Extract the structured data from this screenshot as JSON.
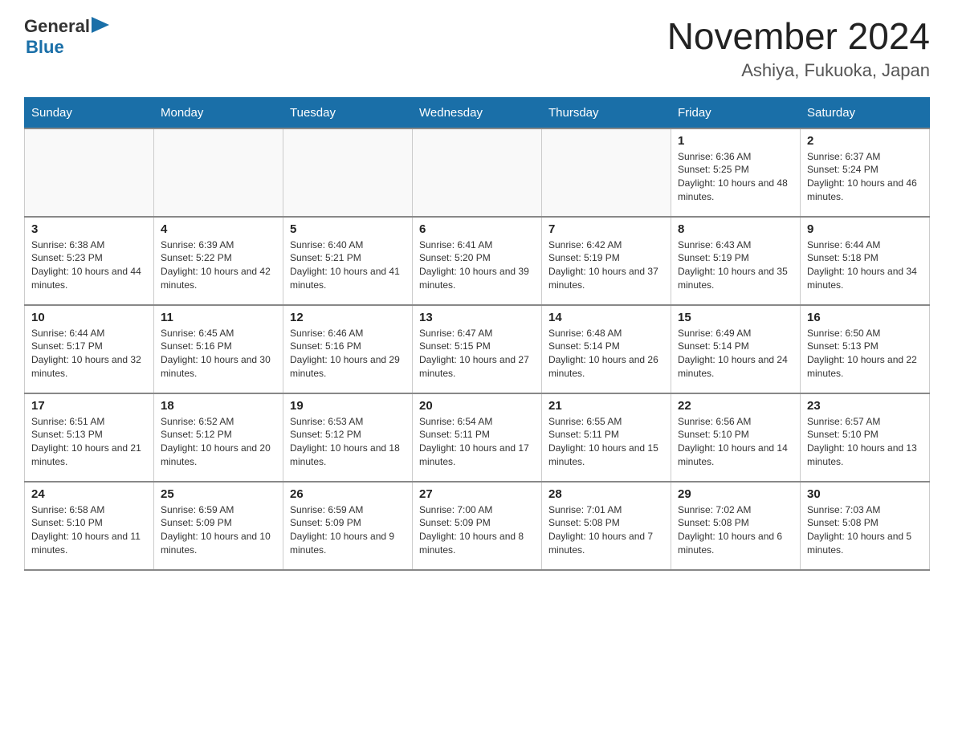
{
  "logo": {
    "general": "General",
    "blue": "Blue",
    "triangle": "▶"
  },
  "title": "November 2024",
  "subtitle": "Ashiya, Fukuoka, Japan",
  "days_of_week": [
    "Sunday",
    "Monday",
    "Tuesday",
    "Wednesday",
    "Thursday",
    "Friday",
    "Saturday"
  ],
  "weeks": [
    [
      {
        "day": "",
        "info": ""
      },
      {
        "day": "",
        "info": ""
      },
      {
        "day": "",
        "info": ""
      },
      {
        "day": "",
        "info": ""
      },
      {
        "day": "",
        "info": ""
      },
      {
        "day": "1",
        "info": "Sunrise: 6:36 AM\nSunset: 5:25 PM\nDaylight: 10 hours and 48 minutes."
      },
      {
        "day": "2",
        "info": "Sunrise: 6:37 AM\nSunset: 5:24 PM\nDaylight: 10 hours and 46 minutes."
      }
    ],
    [
      {
        "day": "3",
        "info": "Sunrise: 6:38 AM\nSunset: 5:23 PM\nDaylight: 10 hours and 44 minutes."
      },
      {
        "day": "4",
        "info": "Sunrise: 6:39 AM\nSunset: 5:22 PM\nDaylight: 10 hours and 42 minutes."
      },
      {
        "day": "5",
        "info": "Sunrise: 6:40 AM\nSunset: 5:21 PM\nDaylight: 10 hours and 41 minutes."
      },
      {
        "day": "6",
        "info": "Sunrise: 6:41 AM\nSunset: 5:20 PM\nDaylight: 10 hours and 39 minutes."
      },
      {
        "day": "7",
        "info": "Sunrise: 6:42 AM\nSunset: 5:19 PM\nDaylight: 10 hours and 37 minutes."
      },
      {
        "day": "8",
        "info": "Sunrise: 6:43 AM\nSunset: 5:19 PM\nDaylight: 10 hours and 35 minutes."
      },
      {
        "day": "9",
        "info": "Sunrise: 6:44 AM\nSunset: 5:18 PM\nDaylight: 10 hours and 34 minutes."
      }
    ],
    [
      {
        "day": "10",
        "info": "Sunrise: 6:44 AM\nSunset: 5:17 PM\nDaylight: 10 hours and 32 minutes."
      },
      {
        "day": "11",
        "info": "Sunrise: 6:45 AM\nSunset: 5:16 PM\nDaylight: 10 hours and 30 minutes."
      },
      {
        "day": "12",
        "info": "Sunrise: 6:46 AM\nSunset: 5:16 PM\nDaylight: 10 hours and 29 minutes."
      },
      {
        "day": "13",
        "info": "Sunrise: 6:47 AM\nSunset: 5:15 PM\nDaylight: 10 hours and 27 minutes."
      },
      {
        "day": "14",
        "info": "Sunrise: 6:48 AM\nSunset: 5:14 PM\nDaylight: 10 hours and 26 minutes."
      },
      {
        "day": "15",
        "info": "Sunrise: 6:49 AM\nSunset: 5:14 PM\nDaylight: 10 hours and 24 minutes."
      },
      {
        "day": "16",
        "info": "Sunrise: 6:50 AM\nSunset: 5:13 PM\nDaylight: 10 hours and 22 minutes."
      }
    ],
    [
      {
        "day": "17",
        "info": "Sunrise: 6:51 AM\nSunset: 5:13 PM\nDaylight: 10 hours and 21 minutes."
      },
      {
        "day": "18",
        "info": "Sunrise: 6:52 AM\nSunset: 5:12 PM\nDaylight: 10 hours and 20 minutes."
      },
      {
        "day": "19",
        "info": "Sunrise: 6:53 AM\nSunset: 5:12 PM\nDaylight: 10 hours and 18 minutes."
      },
      {
        "day": "20",
        "info": "Sunrise: 6:54 AM\nSunset: 5:11 PM\nDaylight: 10 hours and 17 minutes."
      },
      {
        "day": "21",
        "info": "Sunrise: 6:55 AM\nSunset: 5:11 PM\nDaylight: 10 hours and 15 minutes."
      },
      {
        "day": "22",
        "info": "Sunrise: 6:56 AM\nSunset: 5:10 PM\nDaylight: 10 hours and 14 minutes."
      },
      {
        "day": "23",
        "info": "Sunrise: 6:57 AM\nSunset: 5:10 PM\nDaylight: 10 hours and 13 minutes."
      }
    ],
    [
      {
        "day": "24",
        "info": "Sunrise: 6:58 AM\nSunset: 5:10 PM\nDaylight: 10 hours and 11 minutes."
      },
      {
        "day": "25",
        "info": "Sunrise: 6:59 AM\nSunset: 5:09 PM\nDaylight: 10 hours and 10 minutes."
      },
      {
        "day": "26",
        "info": "Sunrise: 6:59 AM\nSunset: 5:09 PM\nDaylight: 10 hours and 9 minutes."
      },
      {
        "day": "27",
        "info": "Sunrise: 7:00 AM\nSunset: 5:09 PM\nDaylight: 10 hours and 8 minutes."
      },
      {
        "day": "28",
        "info": "Sunrise: 7:01 AM\nSunset: 5:08 PM\nDaylight: 10 hours and 7 minutes."
      },
      {
        "day": "29",
        "info": "Sunrise: 7:02 AM\nSunset: 5:08 PM\nDaylight: 10 hours and 6 minutes."
      },
      {
        "day": "30",
        "info": "Sunrise: 7:03 AM\nSunset: 5:08 PM\nDaylight: 10 hours and 5 minutes."
      }
    ]
  ]
}
